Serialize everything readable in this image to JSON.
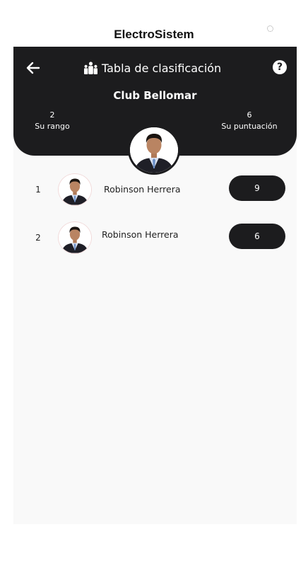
{
  "app": {
    "title": "ElectroSistem"
  },
  "header": {
    "title": "Tabla de clasificación",
    "club_name": "Club Bellomar",
    "rank": {
      "value": "2",
      "label": "Su rango"
    },
    "score": {
      "value": "6",
      "label": "Su puntuación"
    },
    "help_label": "?"
  },
  "leaderboard": [
    {
      "rank": "1",
      "name": "Robinson Herrera",
      "score": "9"
    },
    {
      "rank": "2",
      "name": "Robinson Herrera",
      "score": "6"
    }
  ],
  "icons": {
    "back": "arrow-left-icon",
    "title": "group-leaderboard-icon",
    "help": "question-circle-icon",
    "loading": "spinner-icon"
  },
  "colors": {
    "header_bg": "#1c1c1e",
    "content_bg": "#f9f9f9",
    "button_bg": "#1c1c1e",
    "text_light": "#ffffff"
  }
}
